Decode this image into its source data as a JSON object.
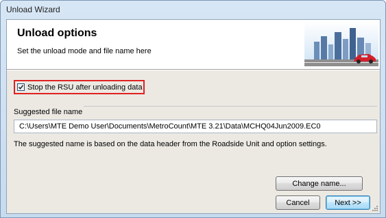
{
  "window": {
    "title": "Unload Wizard"
  },
  "header": {
    "title": "Unload options",
    "subtitle": "Set the unload mode and file name here"
  },
  "options": {
    "stop_rsu_label": "Stop the RSU after unloading data",
    "stop_rsu_checked": true
  },
  "file": {
    "group_label": "Suggested file name",
    "value": "C:\\Users\\MTE Demo User\\Documents\\MetroCount\\MTE 3.21\\Data\\MCHQ04Jun2009.EC0",
    "note": "The suggested name is based on the data header from the Roadside Unit and option settings."
  },
  "buttons": {
    "change_name": "Change name...",
    "cancel": "Cancel",
    "next": "Next >>"
  },
  "icons": {
    "header_art": "city-skyline-car-image",
    "checkbox": "checkmark-icon",
    "resize": "resize-grip-icon"
  },
  "colors": {
    "highlight_border": "#e02020",
    "default_button": "#3c7fb1",
    "title_bar": "#c7dbef"
  }
}
